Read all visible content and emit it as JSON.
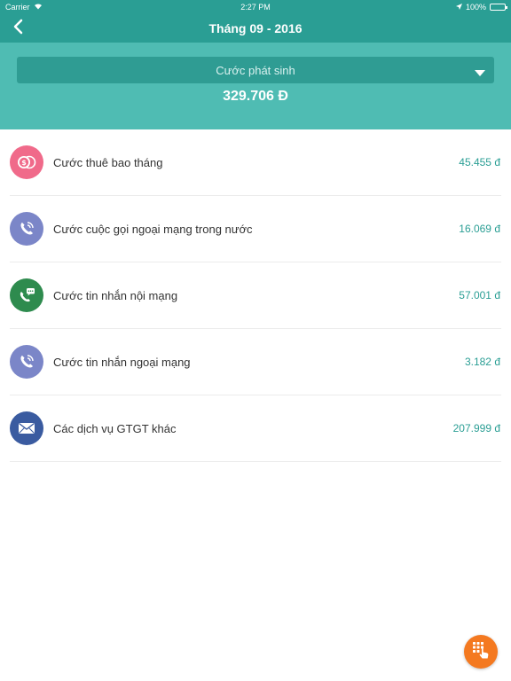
{
  "status_bar": {
    "carrier": "Carrier",
    "time": "2:27 PM",
    "battery": "100%",
    "battery_level": 1.0
  },
  "nav": {
    "title": "Tháng 09 - 2016",
    "back_icon": "chevron-left-icon"
  },
  "summary": {
    "dropdown_selected": "Cước phát sinh",
    "total": "329.706 Đ"
  },
  "items": [
    {
      "label": "Cước thuê bao tháng",
      "amount": "45.455 đ",
      "icon": "coins-icon",
      "color": "#f06a8a"
    },
    {
      "label": "Cước cuộc gọi ngoại mạng trong nước",
      "amount": "16.069 đ",
      "icon": "phone-call-icon",
      "color": "#7b86c8"
    },
    {
      "label": "Cước tin nhắn nội mạng",
      "amount": "57.001 đ",
      "icon": "phone-message-icon",
      "color": "#2e8b4e"
    },
    {
      "label": "Cước tin nhắn ngoại mạng",
      "amount": "3.182 đ",
      "icon": "phone-call-icon",
      "color": "#7b86c8"
    },
    {
      "label": "Các dịch vụ GTGT khác",
      "amount": "207.999 đ",
      "icon": "envelope-icon",
      "color": "#3a5ba0"
    }
  ],
  "colors": {
    "header": "#2a9e94",
    "summary_bg": "#4fbcb3",
    "accent_amount": "#2a9e94",
    "fab": "#f47920"
  },
  "fab": {
    "icon": "keypad-tap-icon"
  }
}
